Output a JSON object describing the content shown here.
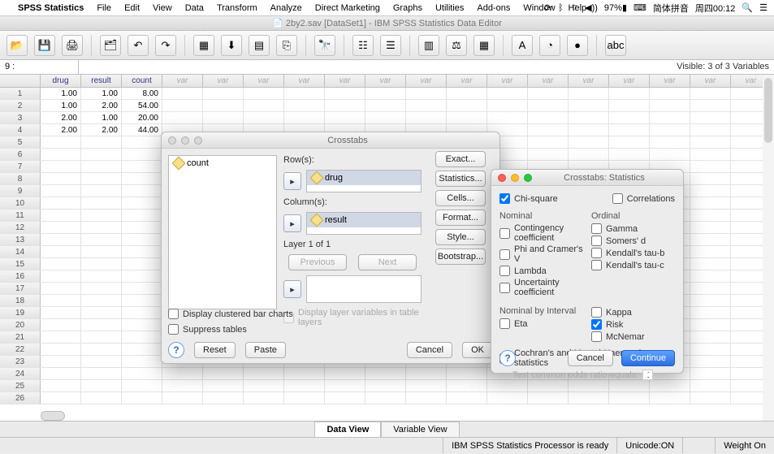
{
  "menubar": {
    "app": "SPSS Statistics",
    "items": [
      "File",
      "Edit",
      "View",
      "Data",
      "Transform",
      "Analyze",
      "Direct Marketing",
      "Graphs",
      "Utilities",
      "Add-ons",
      "Window",
      "Help"
    ],
    "status": {
      "battery": "97%",
      "ime": "简体拼音",
      "datetime": "周四00:12"
    }
  },
  "titlebar": "2by2.sav [DataSet1] - IBM SPSS Statistics Data Editor",
  "formula": {
    "cellref": "9 :",
    "visible": "Visible: 3 of 3 Variables"
  },
  "columns": {
    "vars": [
      "drug",
      "result",
      "count"
    ],
    "generic": "var"
  },
  "data_rows": [
    {
      "n": "1",
      "drug": "1.00",
      "result": "1.00",
      "count": "8.00"
    },
    {
      "n": "2",
      "drug": "1.00",
      "result": "2.00",
      "count": "54.00"
    },
    {
      "n": "3",
      "drug": "2.00",
      "result": "1.00",
      "count": "20.00"
    },
    {
      "n": "4",
      "drug": "2.00",
      "result": "2.00",
      "count": "44.00"
    }
  ],
  "empty_rows": [
    "5",
    "6",
    "7",
    "8",
    "9",
    "10",
    "11",
    "12",
    "13",
    "14",
    "15",
    "16",
    "17",
    "18",
    "19",
    "20",
    "21",
    "22",
    "23",
    "24",
    "25",
    "26"
  ],
  "tabs": {
    "data_view": "Data View",
    "variable_view": "Variable View"
  },
  "statusbar": {
    "processor": "IBM SPSS Statistics Processor is ready",
    "unicode": "Unicode:ON",
    "weight": "Weight On"
  },
  "crosstabs": {
    "title": "Crosstabs",
    "var_in_list": "count",
    "rows_label": "Row(s):",
    "rows_var": "drug",
    "cols_label": "Column(s):",
    "cols_var": "result",
    "layer_label": "Layer 1 of 1",
    "previous": "Previous",
    "next": "Next",
    "display_layer_vars": "Display layer variables in table layers",
    "display_clustered": "Display clustered bar charts",
    "suppress": "Suppress tables",
    "buttons": {
      "reset": "Reset",
      "paste": "Paste",
      "cancel": "Cancel",
      "ok": "OK"
    },
    "side_buttons": [
      "Exact...",
      "Statistics...",
      "Cells...",
      "Format...",
      "Style...",
      "Bootstrap..."
    ]
  },
  "stats": {
    "title": "Crosstabs: Statistics",
    "chi": "Chi-square",
    "correlations": "Correlations",
    "nominal": "Nominal",
    "ordinal": "Ordinal",
    "contingency": "Contingency coefficient",
    "gamma": "Gamma",
    "phi": "Phi and Cramer's V",
    "somers": "Somers' d",
    "lambda": "Lambda",
    "kendall_b": "Kendall's tau-b",
    "uncertainty": "Uncertainty coefficient",
    "kendall_c": "Kendall's tau-c",
    "nominal_interval": "Nominal by Interval",
    "eta": "Eta",
    "kappa": "Kappa",
    "risk": "Risk",
    "mcnemar": "McNemar",
    "cochran": "Cochran's and Mantel-Haenszel statistics",
    "odds_label": "Test common odds ratio equals:",
    "odds_value": "1",
    "cancel": "Cancel",
    "continue": "Continue"
  }
}
